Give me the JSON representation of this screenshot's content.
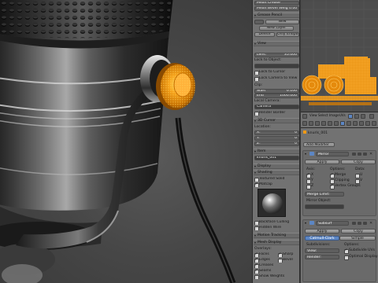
{
  "npanel": {
    "top_fields": [
      "Mean Crease",
      "Mean Bevel Weig 0.00"
    ],
    "grease_pencil_header": "Grease Pencil",
    "gp_buttons": [
      "New",
      "New Layer"
    ],
    "gp_delete": "Delete",
    "gp_only_endpoints": "Only Endpoints",
    "view_header": "View",
    "lens_label": "Lens:",
    "lens_value": "35.000",
    "lock_to_object": "Lock to Object:",
    "lock_to_cursor": "Lock to Cursor",
    "lock_camera_to_view": "Lock Camera to View",
    "clip_label": "Clip:",
    "clip_start_label": "Start",
    "clip_start_value": "0.100",
    "clip_end_label": "End",
    "clip_end_value": "1000.000",
    "local_camera": "Local Camera:",
    "camera_field": "Camera",
    "render_border": "Render Border",
    "cursor_header": "3D Cursor",
    "location_label": "Location:",
    "loc_x_label": "X:",
    "loc_x_value": "0",
    "loc_y_label": "Y:",
    "loc_y_value": "0",
    "loc_z_label": "Z:",
    "loc_z_value": "0",
    "item_header": "Item",
    "item_name": "knurls_001",
    "display_header": "Display",
    "shading_header": "Shading",
    "textured_solid": "Textured Solid",
    "matcap": "Matcap",
    "backface_culling": "Backface Culling",
    "hidden_wire": "Hidden Wire",
    "motion_tracking": "Motion Tracking",
    "mesh_display": "Mesh Display",
    "overlays_label": "Overlays:",
    "overlay_left": [
      "Faces",
      "Edges",
      "Creases",
      "Seams",
      "Show Weights"
    ],
    "overlay_right": [
      "Sharp",
      "Bevel"
    ]
  },
  "uv": {
    "menus": [
      "View",
      "Select",
      "Image",
      "UVs"
    ],
    "bar_label": "New"
  },
  "props": {
    "breadcrumb": "knurls_001",
    "add_modifier": "Add Modifier",
    "mod1_name": "Mirror",
    "mod1_apply": "Apply",
    "mod1_copy": "Copy",
    "axis_label": "Axis:",
    "options_label": "Options:",
    "data_label": "Data:",
    "axes": [
      "X",
      "Y",
      "Z"
    ],
    "mod1_options": [
      "Merge",
      "Clipping",
      "Vertex Groups"
    ],
    "mod1_data": [
      "U",
      "V"
    ],
    "merge_limit": "Merge Limit:",
    "mirror_object": "Mirror Object:",
    "mod2_name": "Subsurf",
    "mod2_apply": "Apply",
    "mod2_copy": "Copy",
    "catmull": "Catmull-Clark",
    "simple": "Simple",
    "subdivisions": "Subdivisions:",
    "options2": "Options:",
    "view_field": "View:",
    "render_field": "Render:",
    "subdivide_uvs": "Subdivide UVs",
    "optimal_display": "Optimal Display"
  },
  "colors": {
    "accent_orange": "#f29a14",
    "panel_gray": "#727272",
    "viewport_bg": "#474747",
    "selection_blue": "#5c86c4"
  }
}
